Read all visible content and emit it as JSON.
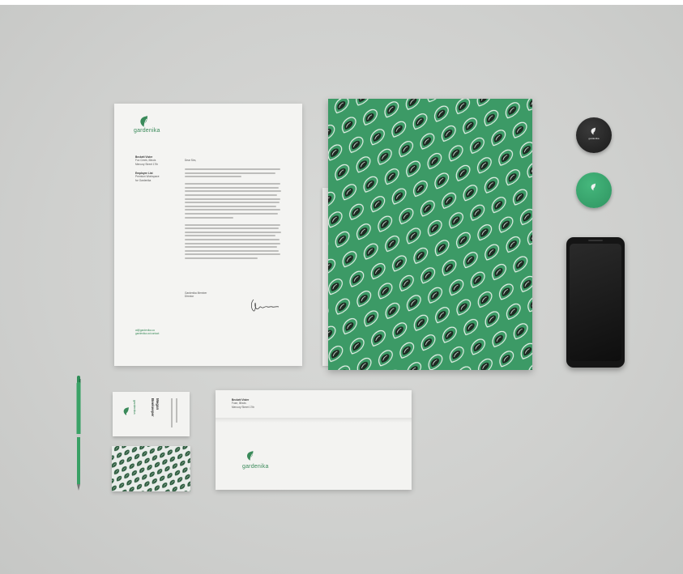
{
  "brand": {
    "name": "gardenika",
    "accent": "#3a8a5a",
    "pattern_green": "#3c9a66",
    "dark": "#1c1c1c"
  },
  "letterhead": {
    "sender_name": "Beckett Vister",
    "sender_line1": "Fox Creek, Illinois",
    "sender_line2": "Mercury Street 17th",
    "recipient_name": "Employee List",
    "recipient_line1": "Premium Workspace",
    "recipient_line2": "for Gardenika",
    "salutation": "Dear Sirs,",
    "closing_name": "Gardenika Member",
    "closing_role": "Director",
    "footer_line1": "at@gardenika.co",
    "footer_line2": "gardenika.co/contact"
  },
  "envelope": {
    "name": "Beckett Vister",
    "line1": "Fuse, Illinois",
    "line2": "Mercury Street 17th"
  },
  "business_card": {
    "first_name": "Megan",
    "last_name": "Beekeeper"
  }
}
